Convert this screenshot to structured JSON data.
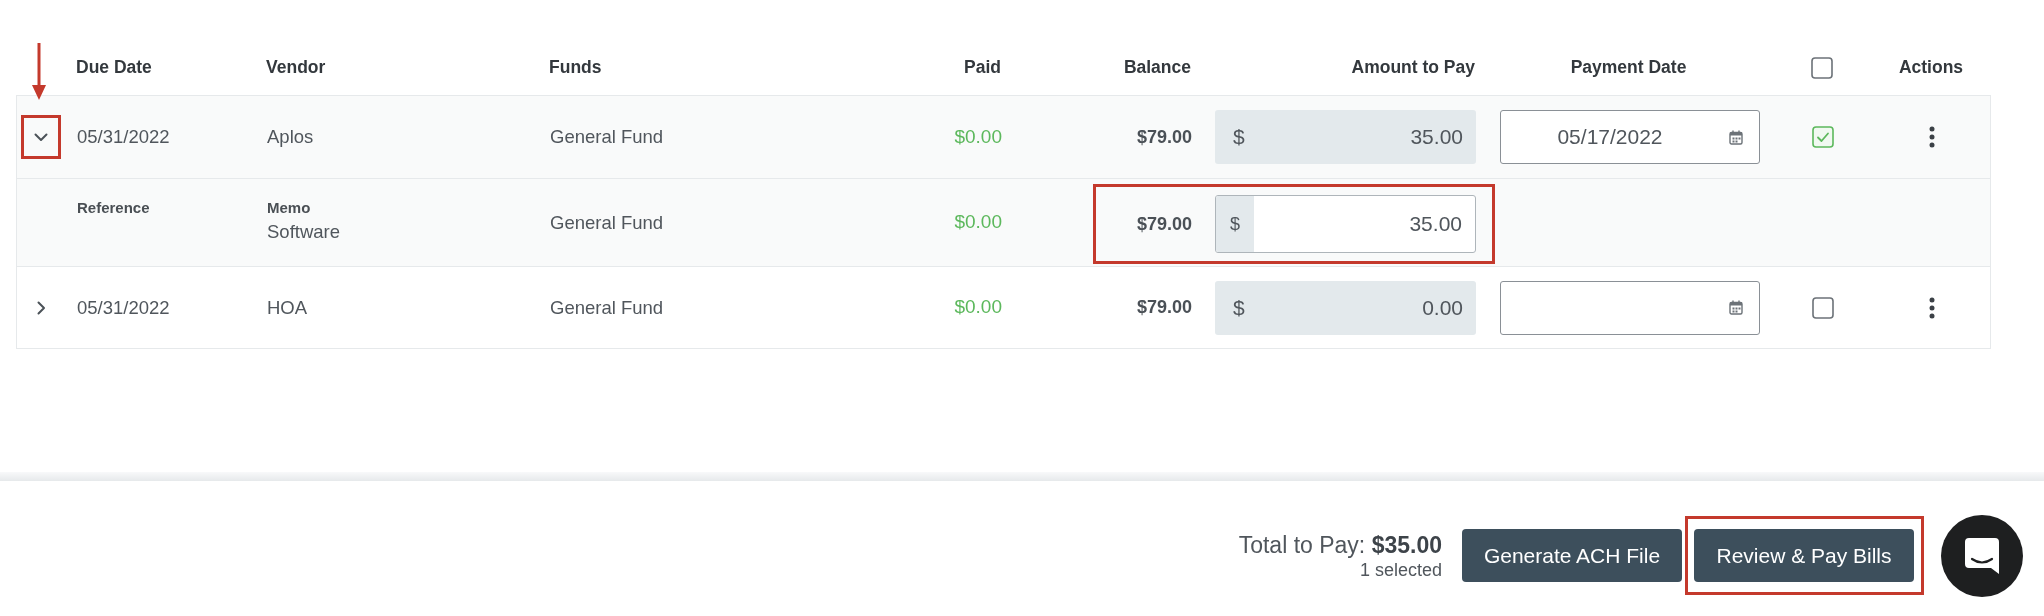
{
  "table": {
    "columns": [
      {
        "kind": "text",
        "label": "Due Date"
      },
      {
        "kind": "text",
        "label": "Vendor"
      },
      {
        "kind": "text",
        "label": "Funds"
      },
      {
        "kind": "text",
        "label": "Paid"
      },
      {
        "kind": "text",
        "label": "Balance"
      },
      {
        "kind": "text",
        "label": "Amount to Pay"
      },
      {
        "kind": "text",
        "label": "Payment Date"
      },
      {
        "kind": "checkbox",
        "checked": false
      },
      {
        "kind": "text",
        "label": "Actions"
      }
    ],
    "rows": [
      {
        "expanded": true,
        "toggle_highlighted": true,
        "pointer_arrow": true,
        "due_date": "05/31/2022",
        "vendor": "Aplos",
        "funds": "General Fund",
        "paid": "$0.00",
        "balance": "$79.00",
        "amount": {
          "prefix": "$",
          "value": "35.00",
          "readonly": true
        },
        "payment_date": "05/17/2022",
        "checked": true,
        "details": [
          {
            "reference_label": "Reference",
            "memo_label": "Memo",
            "memo": "Software",
            "funds": "General Fund",
            "paid": "$0.00",
            "balance": "$79.00",
            "amount": {
              "prefix": "$",
              "value": "35.00",
              "readonly": false
            },
            "highlighted": true
          }
        ]
      },
      {
        "expanded": false,
        "toggle_highlighted": false,
        "pointer_arrow": false,
        "due_date": "05/31/2022",
        "vendor": "HOA",
        "funds": "General Fund",
        "paid": "$0.00",
        "balance": "$79.00",
        "amount": {
          "prefix": "$",
          "value": "0.00",
          "readonly": true
        },
        "checked": false
      }
    ]
  },
  "footer": {
    "total": "Total to Pay: **$35.00**",
    "selected_count": "1 selected",
    "buttons": [
      {
        "label": "Generate ACH File",
        "highlighted": false
      },
      {
        "label": "Review & Pay Bills",
        "highlighted": true
      }
    ]
  }
}
